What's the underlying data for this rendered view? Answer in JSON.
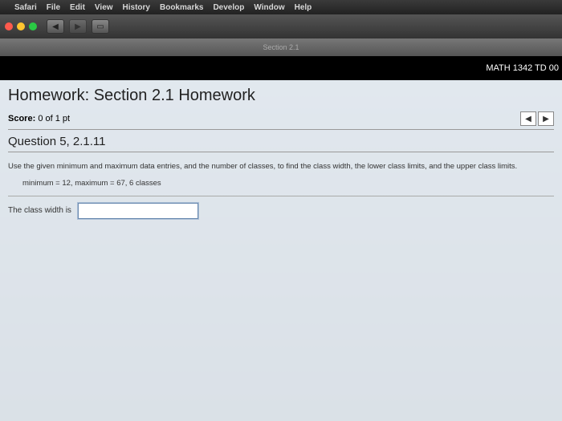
{
  "menubar": {
    "app": "Safari",
    "items": [
      "File",
      "Edit",
      "View",
      "History",
      "Bookmarks",
      "Develop",
      "Window",
      "Help"
    ]
  },
  "tab": {
    "title": "Section 2.1"
  },
  "app_header": {
    "course": "MATH 1342 TD 00"
  },
  "homework": {
    "title": "Homework: Section 2.1 Homework",
    "score_label": "Score:",
    "score_value": "0 of 1 pt",
    "question_title": "Question 5, 2.1.11",
    "prompt": "Use the given minimum and maximum data entries, and the number of classes, to find the class width, the lower class limits, and the upper class limits.",
    "data_line": "minimum = 12, maximum = 67, 6 classes",
    "answer_label": "The class width is",
    "answer_value": ""
  }
}
